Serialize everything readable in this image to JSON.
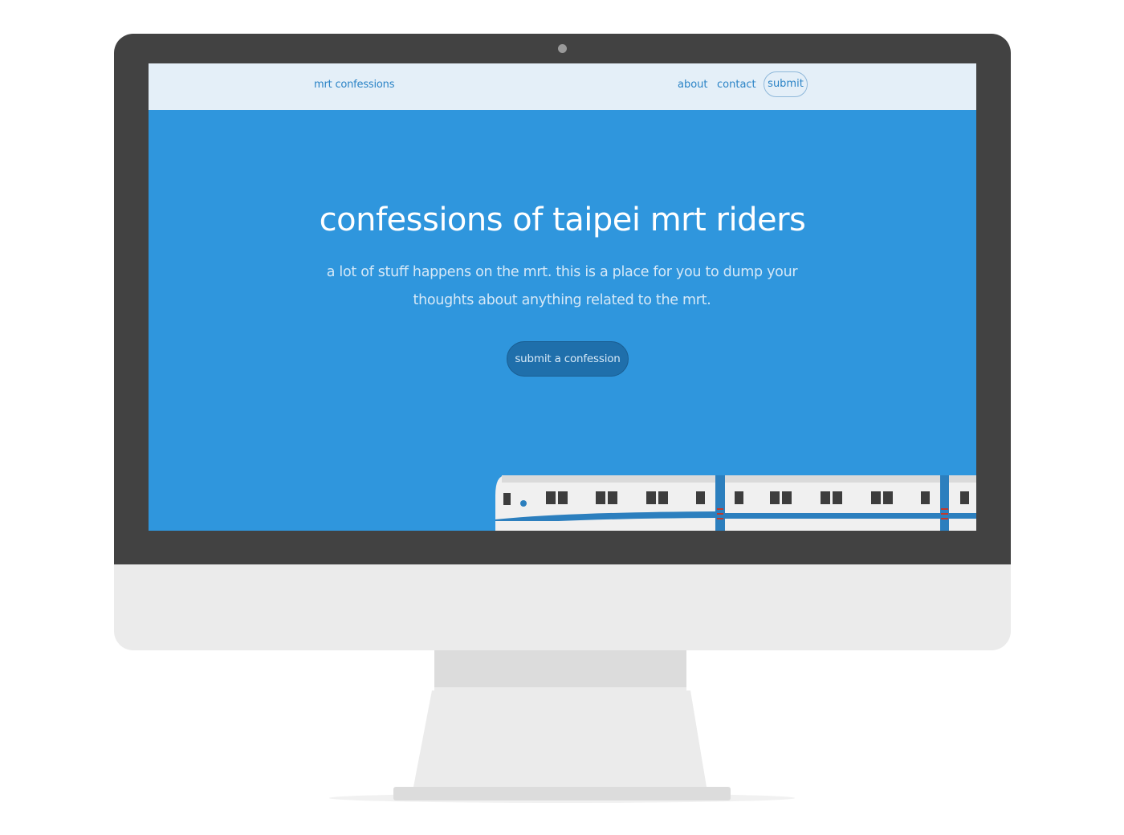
{
  "site": {
    "brand": "mrt confessions",
    "nav": {
      "about": "about",
      "contact": "contact",
      "submit": "submit"
    }
  },
  "hero": {
    "title": "confessions of taipei mrt riders",
    "subtitle_line1": "a lot of stuff happens on the mrt. this is a place for you to dump your",
    "subtitle_line2": "thoughts about anything related to the mrt.",
    "cta": "submit a confession"
  },
  "colors": {
    "hero_background": "#2f96dd",
    "nav_background": "#e4eff8",
    "accent": "#2a83c6",
    "cta_background": "#1f6fab",
    "monitor_bezel": "#424242",
    "monitor_chin": "#ebebeb"
  },
  "illustration": {
    "name": "mrt-train",
    "icons": [
      "train-illustration",
      "webcam-icon"
    ]
  }
}
